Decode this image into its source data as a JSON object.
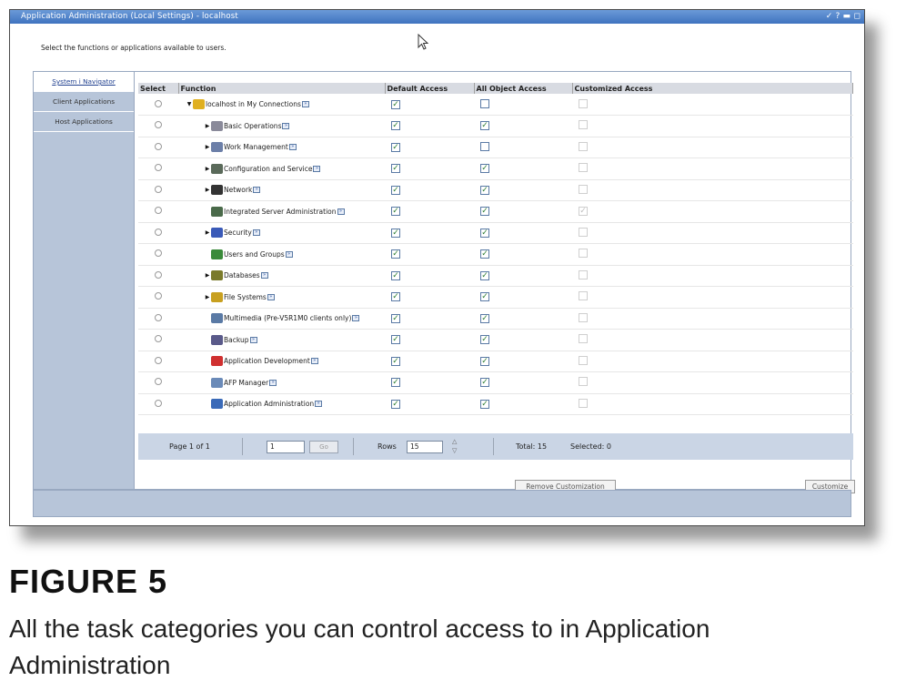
{
  "window": {
    "title": "Application Administration (Local Settings) - localhost",
    "controls": "✓ ? ▬ ◻"
  },
  "instructions": "Select the functions or applications available to users.",
  "nav": {
    "tabs": [
      "System i Navigator",
      "Client Applications",
      "Host Applications"
    ]
  },
  "table": {
    "columns": [
      "Select",
      "Function",
      "Default Access",
      "All Object Access",
      "Customized Access"
    ],
    "rows": [
      {
        "label": "localhost in My Connections",
        "indent": 0,
        "expand": "▼",
        "icon_color": "#e0b020",
        "default_access": true,
        "all_object": false,
        "customized": false
      },
      {
        "label": "Basic Operations",
        "indent": 1,
        "expand": "▶",
        "icon_color": "#8a8a9a",
        "default_access": true,
        "all_object": true,
        "customized": false
      },
      {
        "label": "Work Management",
        "indent": 1,
        "expand": "▶",
        "icon_color": "#6c7fa8",
        "default_access": true,
        "all_object": false,
        "customized": false
      },
      {
        "label": "Configuration and Service",
        "indent": 1,
        "expand": "▶",
        "icon_color": "#5a6a5a",
        "default_access": true,
        "all_object": true,
        "customized": false
      },
      {
        "label": "Network",
        "indent": 1,
        "expand": "▶",
        "icon_color": "#333333",
        "default_access": true,
        "all_object": true,
        "customized": false
      },
      {
        "label": "Integrated Server Administration",
        "indent": 1,
        "expand": "",
        "icon_color": "#4a6a4a",
        "default_access": true,
        "all_object": true,
        "customized": true
      },
      {
        "label": "Security",
        "indent": 1,
        "expand": "▶",
        "icon_color": "#3a5ab8",
        "default_access": true,
        "all_object": true,
        "customized": false
      },
      {
        "label": "Users and Groups",
        "indent": 1,
        "expand": "",
        "icon_color": "#3a8a3a",
        "default_access": true,
        "all_object": true,
        "customized": false
      },
      {
        "label": "Databases",
        "indent": 1,
        "expand": "▶",
        "icon_color": "#7a7a2a",
        "default_access": true,
        "all_object": true,
        "customized": false
      },
      {
        "label": "File Systems",
        "indent": 1,
        "expand": "▶",
        "icon_color": "#c8a020",
        "default_access": true,
        "all_object": true,
        "customized": false
      },
      {
        "label": "Multimedia (Pre-V5R1M0 clients only)",
        "indent": 1,
        "expand": "",
        "icon_color": "#5a7aa5",
        "default_access": true,
        "all_object": true,
        "customized": false
      },
      {
        "label": "Backup",
        "indent": 1,
        "expand": "",
        "icon_color": "#5a5a8a",
        "default_access": true,
        "all_object": true,
        "customized": false
      },
      {
        "label": "Application Development",
        "indent": 1,
        "expand": "",
        "icon_color": "#d03030",
        "default_access": true,
        "all_object": true,
        "customized": false
      },
      {
        "label": "AFP Manager",
        "indent": 1,
        "expand": "",
        "icon_color": "#6a8ab8",
        "default_access": true,
        "all_object": true,
        "customized": false
      },
      {
        "label": "Application Administration",
        "indent": 1,
        "expand": "",
        "icon_color": "#3a6ab8",
        "default_access": true,
        "all_object": true,
        "customized": false
      }
    ]
  },
  "pager": {
    "page_text": "Page 1 of 1",
    "page_input": "1",
    "go": "Go",
    "rows_label": "Rows",
    "rows_value": "15",
    "total": "Total: 15",
    "selected": "Selected: 0"
  },
  "buttons": {
    "remove_customization": "Remove Customization",
    "customize": "Customize"
  },
  "figure": {
    "label": "FIGURE 5",
    "caption": "All the task categories you can control access to in Application Administration"
  }
}
